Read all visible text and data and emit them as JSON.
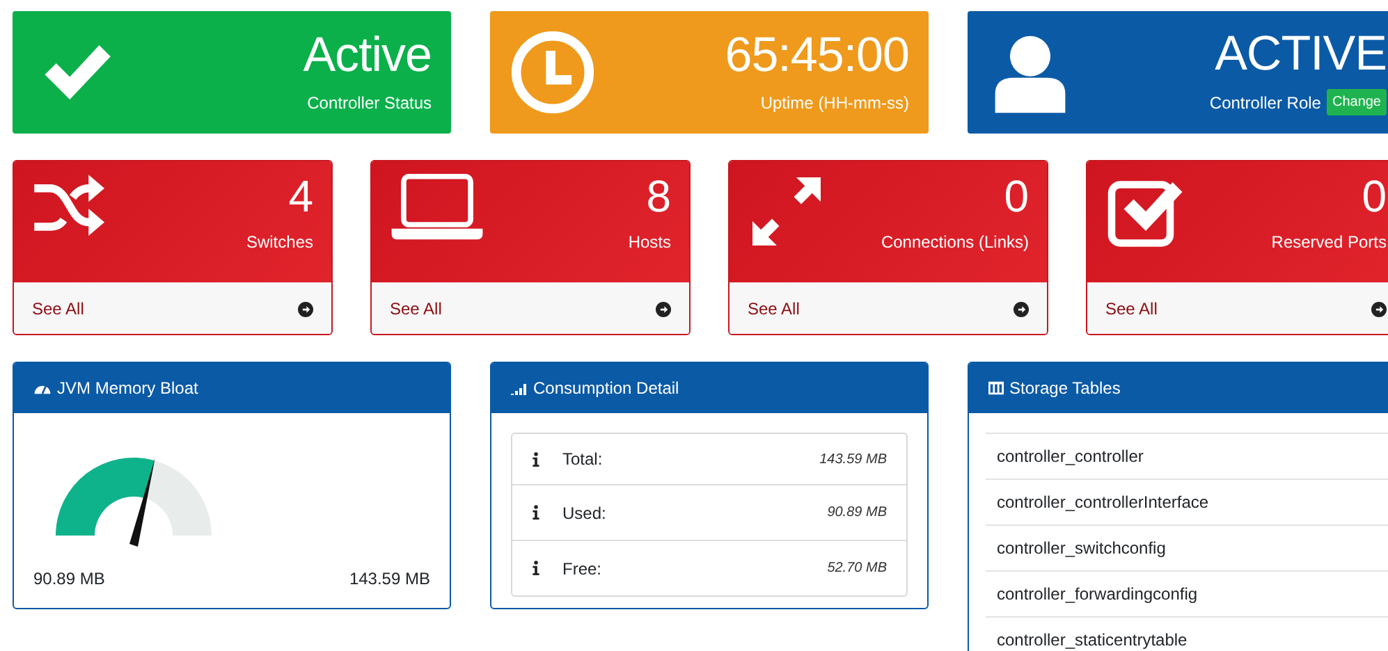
{
  "status_tiles": [
    {
      "kind": "check",
      "color": "#0bb04b",
      "value": "Active",
      "label": "Controller Status"
    },
    {
      "kind": "clock",
      "color": "#ef9a1c",
      "value": "65:45:00",
      "label": "Uptime (HH-mm-ss)"
    },
    {
      "kind": "user",
      "color": "#0b5aa6",
      "value": "ACTIVE",
      "label": "Controller Role",
      "button": "Change"
    }
  ],
  "stat_cards": [
    {
      "kind": "shuffle",
      "count": "4",
      "label": "Switches",
      "link": "See All"
    },
    {
      "kind": "laptop",
      "count": "8",
      "label": "Hosts",
      "link": "See All"
    },
    {
      "kind": "arrows",
      "count": "0",
      "label": "Connections (Links)",
      "link": "See All"
    },
    {
      "kind": "checkbox",
      "count": "0",
      "label": "Reserved Ports",
      "link": "See All"
    }
  ],
  "memory_panel": {
    "title": "JVM Memory Bloat",
    "level": 0.633,
    "used": "90.89 MB",
    "total": "143.59 MB"
  },
  "consumption_panel": {
    "title": "Consumption Detail",
    "rows": [
      {
        "label": "Total:",
        "value": "143.59 MB"
      },
      {
        "label": "Used:",
        "value": "90.89 MB"
      },
      {
        "label": "Free:",
        "value": "52.70 MB"
      }
    ]
  },
  "storage_panel": {
    "title": "Storage Tables",
    "tables": [
      "controller_controller",
      "controller_controllerInterface",
      "controller_switchconfig",
      "controller_forwardingconfig",
      "controller_staticentrytable"
    ]
  }
}
